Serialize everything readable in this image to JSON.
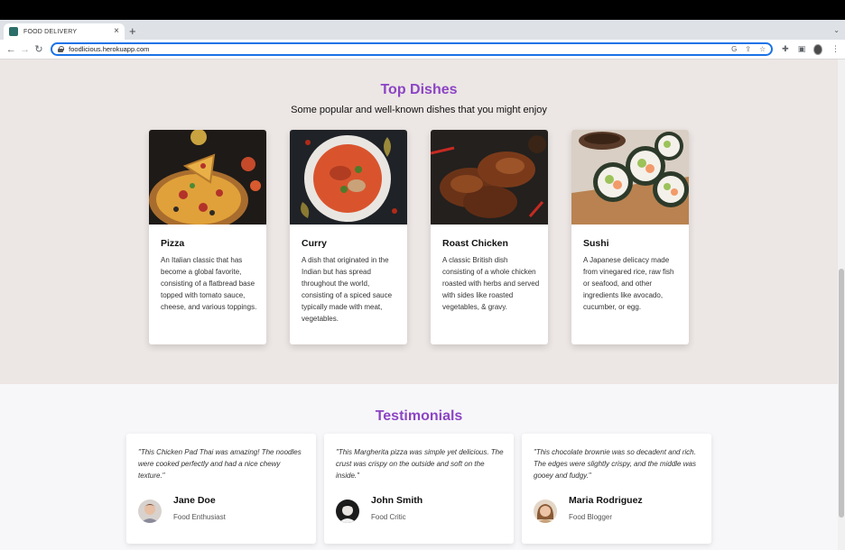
{
  "browser": {
    "tab_title": "FOOD DELIVERY",
    "url": "foodlicious.herokuapp.com"
  },
  "icons": {
    "close": "×",
    "new_tab": "+",
    "back": "←",
    "forward": "→",
    "reload": "↻",
    "tab_menu": "⌄",
    "google": "G",
    "share": "⇪",
    "star": "☆",
    "extensions": "✚",
    "sidepanel": "▣",
    "more": "⋮"
  },
  "dishes_section": {
    "title": "Top Dishes",
    "subtitle": "Some popular and well-known dishes that you might enjoy",
    "items": [
      {
        "name": "Pizza",
        "description": "An Italian classic that has become a global favorite, consisting of a flatbread base topped with tomato sauce, cheese, and various toppings."
      },
      {
        "name": "Curry",
        "description": "A dish that originated in the Indian but has spread throughout the world, consisting of a spiced sauce typically made with meat, vegetables."
      },
      {
        "name": "Roast Chicken",
        "description": "A classic British dish consisting of a whole chicken roasted with herbs and served with sides like roasted vegetables, & gravy."
      },
      {
        "name": "Sushi",
        "description": "A Japanese delicacy made from vinegared rice, raw fish or seafood, and other ingredients like avocado, cucumber, or egg."
      }
    ]
  },
  "testimonials_section": {
    "title": "Testimonials",
    "items": [
      {
        "quote": "\"This Chicken Pad Thai was amazing! The noodles were cooked perfectly and had a nice chewy texture.\"",
        "name": "Jane Doe",
        "role": "Food Enthusiast"
      },
      {
        "quote": "\"This Margherita pizza was simple yet delicious. The crust was crispy on the outside and soft on the inside.\"",
        "name": "John Smith",
        "role": "Food Critic"
      },
      {
        "quote": "\"This chocolate brownie was so decadent and rich. The edges were slightly crispy, and the middle was gooey and fudgy.\"",
        "name": "Maria Rodriguez",
        "role": "Food Blogger"
      }
    ]
  },
  "colors": {
    "accent": "#8c44c4",
    "dishes_bg": "#ece6e4",
    "testimonials_bg": "#f7f7f9"
  }
}
